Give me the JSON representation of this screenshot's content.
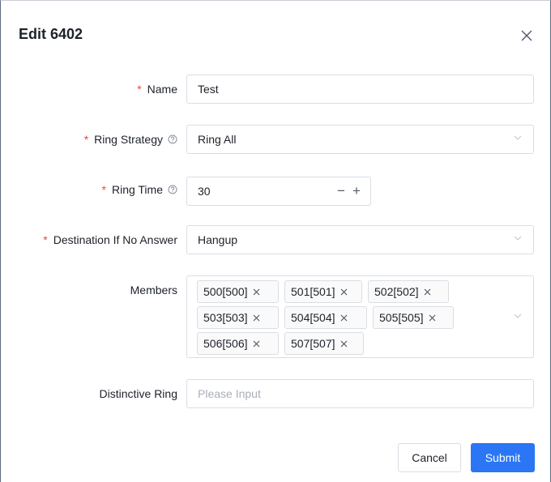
{
  "dialog": {
    "title": "Edit 6402",
    "close_icon": "close-icon"
  },
  "form": {
    "name": {
      "label": "Name",
      "required_mark": "*",
      "value": "Test"
    },
    "ring_strategy": {
      "label": "Ring Strategy",
      "required_mark": "*",
      "value": "Ring All",
      "help_icon": "question-circle-icon"
    },
    "ring_time": {
      "label": "Ring Time",
      "required_mark": "*",
      "value": "30",
      "minus": "−",
      "plus": "+",
      "help_icon": "question-circle-icon"
    },
    "destination": {
      "label": "Destination If No Answer",
      "required_mark": "*",
      "value": "Hangup"
    },
    "members": {
      "label": "Members",
      "tags": [
        "500[500]",
        "501[501]",
        "502[502]",
        "503[503]",
        "504[504]",
        "505[505]",
        "506[506]",
        "507[507]"
      ]
    },
    "distinctive_ring": {
      "label": "Distinctive Ring",
      "value": "",
      "placeholder": "Please Input"
    }
  },
  "footer": {
    "cancel_label": "Cancel",
    "submit_label": "Submit"
  },
  "colors": {
    "primary": "#2a76f4",
    "required": "#f53f3f",
    "border": "#d9dde3",
    "placeholder": "#a9aeb8"
  }
}
